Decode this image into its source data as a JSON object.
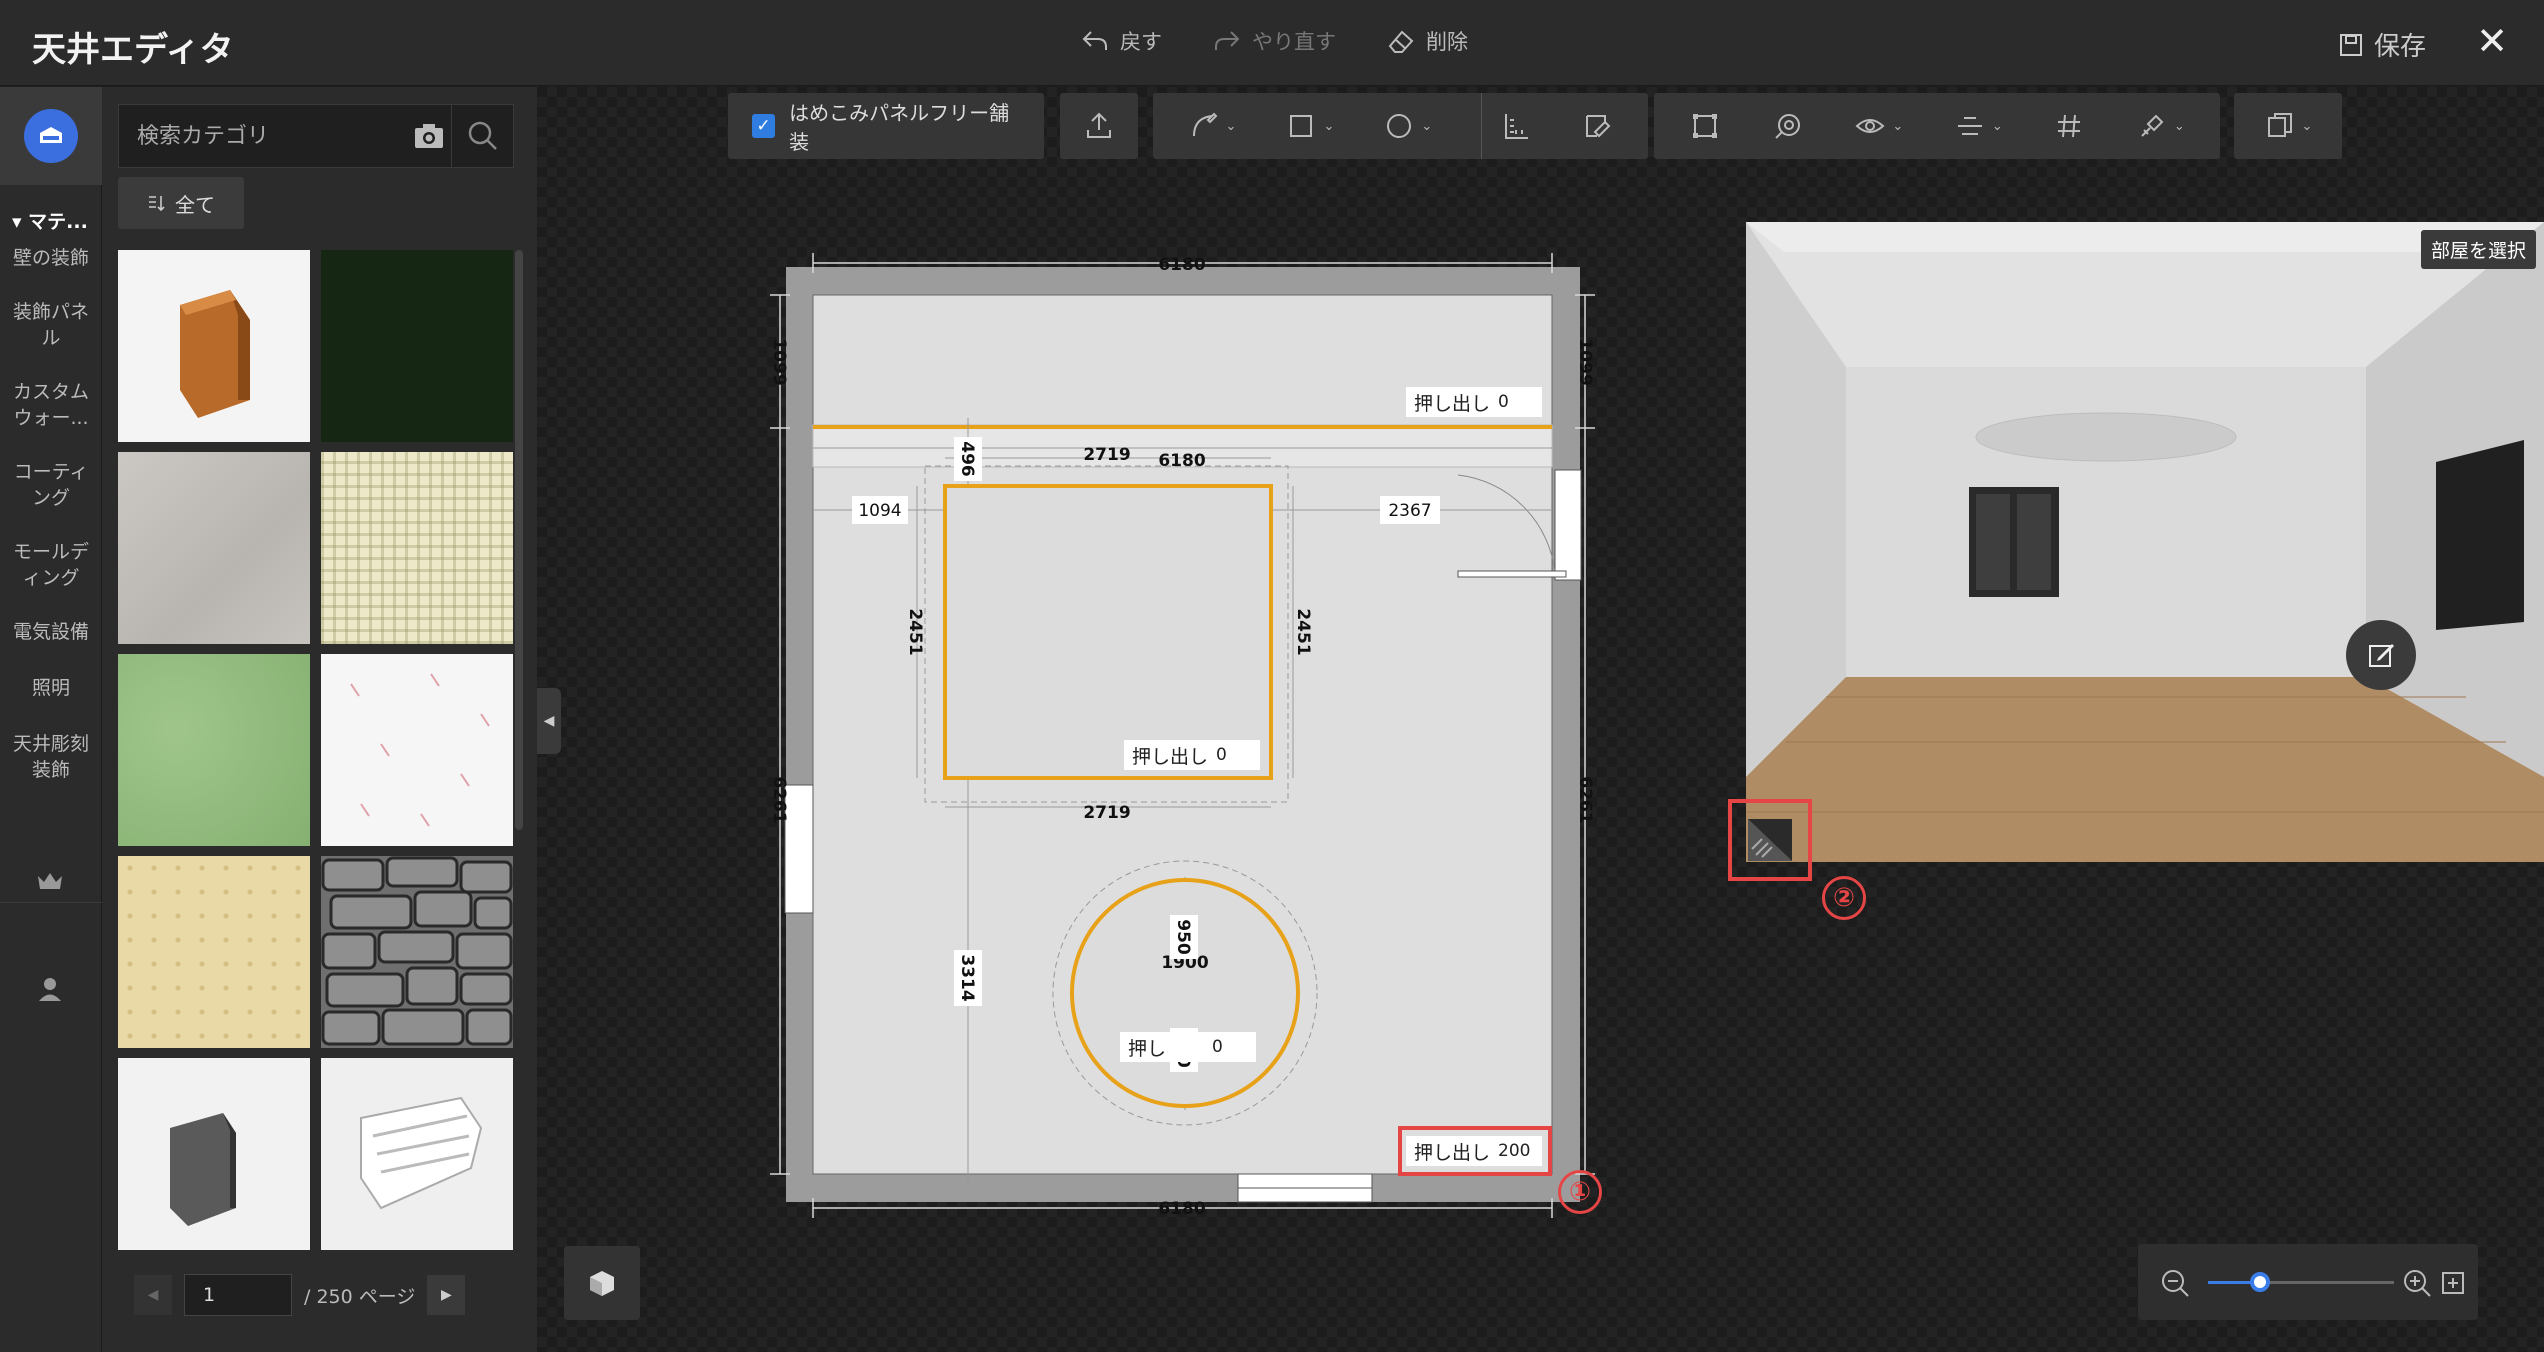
{
  "titlebar": {
    "title": "天井エディタ",
    "undo": "戻す",
    "redo": "やり直す",
    "delete": "削除",
    "save": "保存"
  },
  "rail": {
    "group_head": "マテ...",
    "items": [
      "壁の装飾",
      "装飾パネル",
      "カスタムウォー...",
      "コーティング",
      "モールディング",
      "電気設備",
      "照明",
      "天井彫刻装飾"
    ]
  },
  "panel": {
    "search_placeholder": "検索カテゴリ",
    "filter_label": "全て",
    "page_value": "1",
    "page_total": "/ 250 ページ"
  },
  "toolbar": {
    "checkbox_label": "はめこみパネルフリー舗装",
    "checkbox_checked": true
  },
  "plan": {
    "top_width": "6180",
    "bottom_width": "6180",
    "inner_width": "6180",
    "left_top_h": "1099",
    "right_top_h": "1099",
    "left_bottom_h": "6261",
    "right_bottom_h": "6261",
    "rect_top_w": "2719",
    "rect_bottom_w": "2719",
    "rect_left_off": "1094",
    "rect_right_off": "2367",
    "rect_h_left": "2451",
    "rect_h_right": "2451",
    "rect_top_off": "496",
    "circle_dist": "3314",
    "circle_diam": "1900",
    "circle_r_top": "950",
    "circle_r_bottom": "950",
    "extrude_label": "押し出し",
    "extrude_strip_value": "0",
    "extrude_rect_value": "0",
    "extrude_circle_label": "押し",
    "extrude_circle_value": "0",
    "extrude_main_value": "200",
    "marker_1": "①",
    "marker_2": "②"
  },
  "preview": {
    "room_select": "部屋を選択"
  },
  "colors": {
    "accent": "#3a7de8",
    "highlight": "#e64545",
    "shape_stroke": "#e8a21a"
  }
}
